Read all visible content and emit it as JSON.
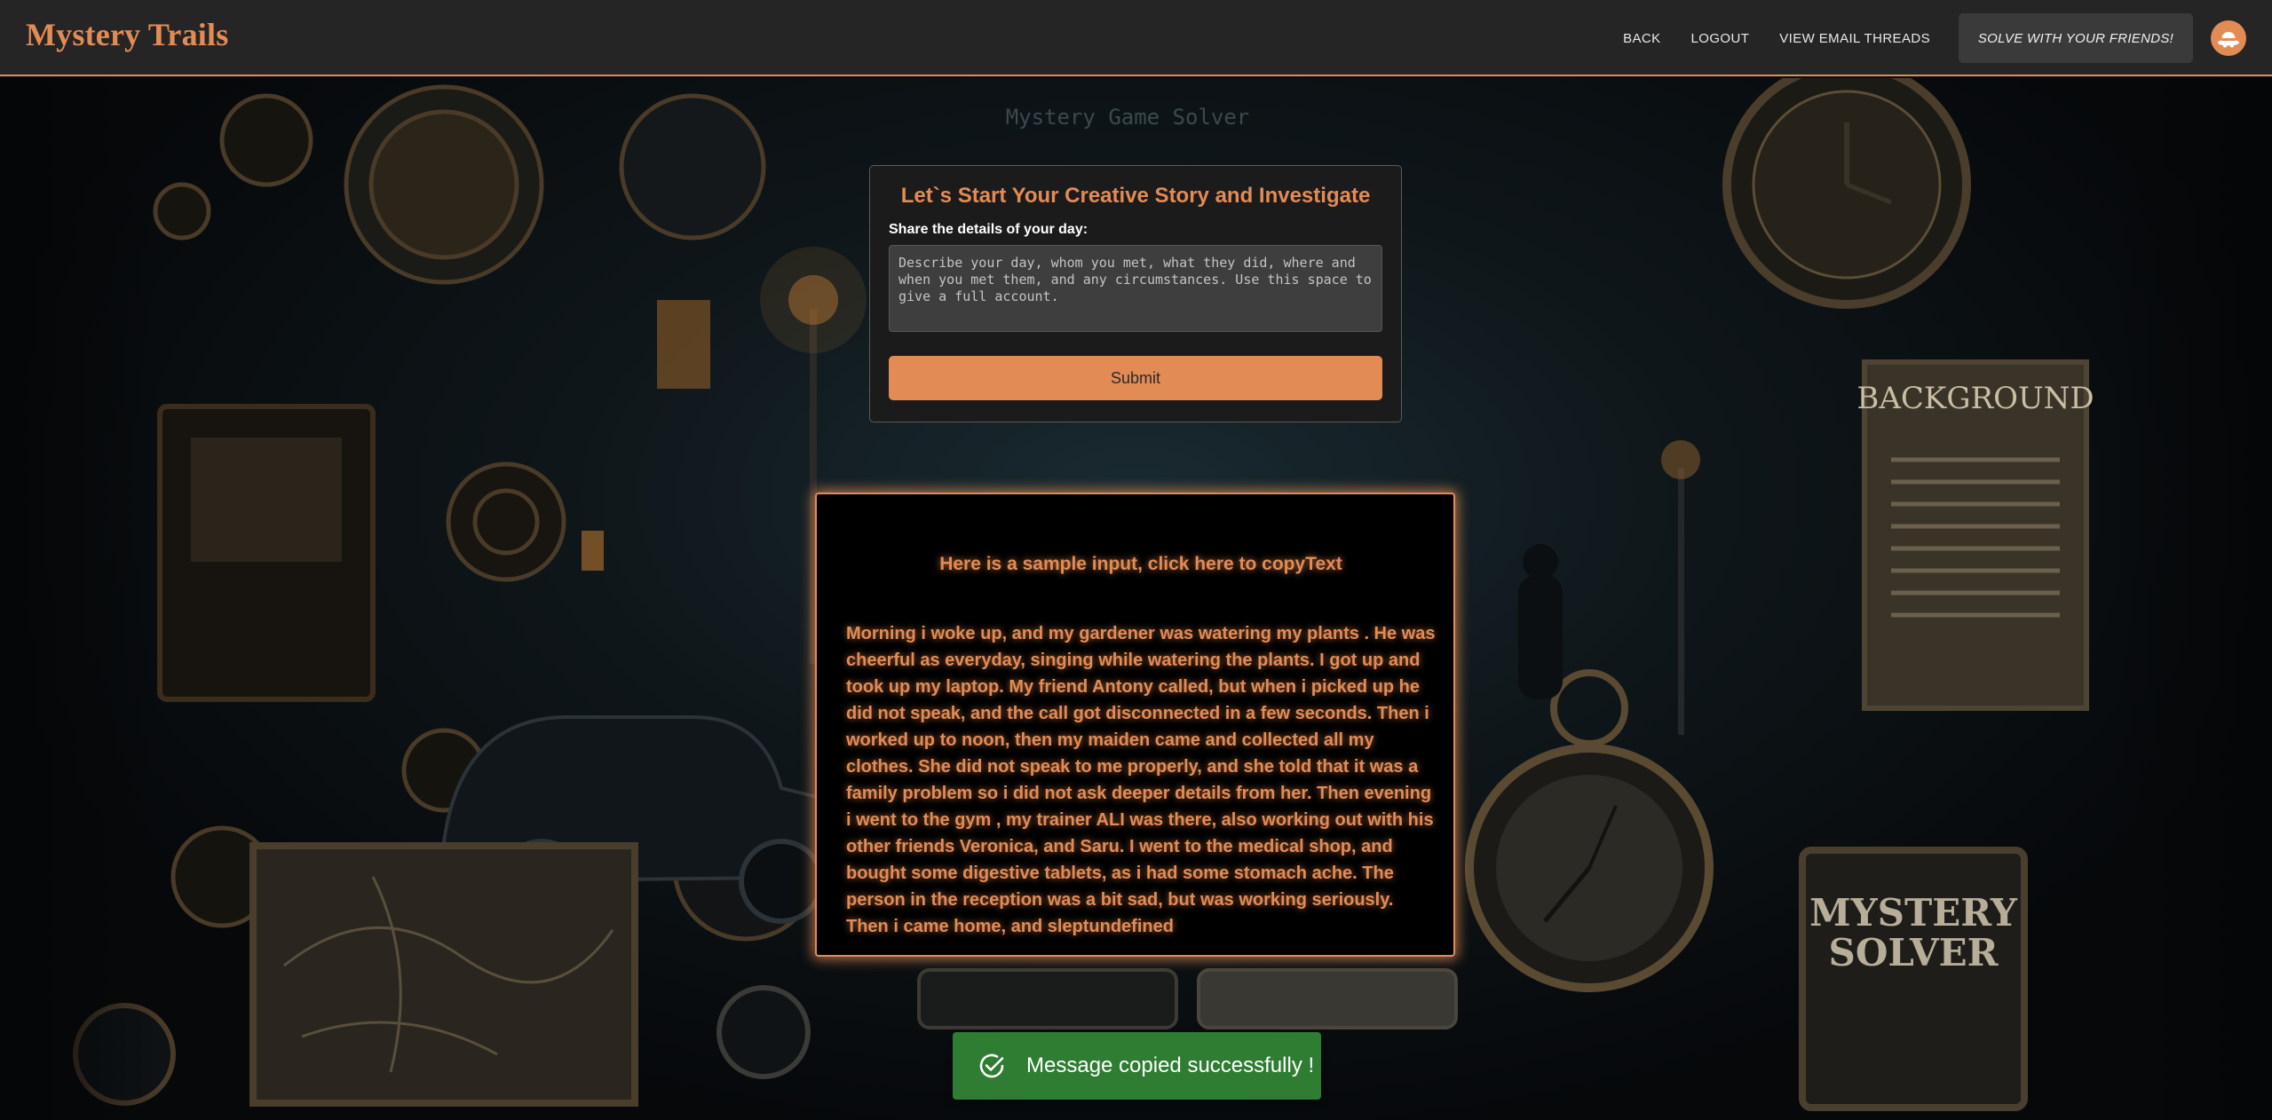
{
  "header": {
    "brand": "Mystery Trails",
    "nav": {
      "back": "BACK",
      "logout": "LOGOUT",
      "email_threads": "VIEW EMAIL THREADS",
      "cta": "SOLVE WITH YOUR FRIENDS!"
    },
    "avatar_icon": "detective-hat-icon"
  },
  "background": {
    "faint_title": "Mystery Game Solver",
    "poster_title": "BACKGROUND",
    "box_title_line1": "MYSTERY",
    "box_title_line2": "SOLVER"
  },
  "form": {
    "title": "Let`s Start Your Creative Story and Investigate",
    "label": "Share the details of your day:",
    "placeholder": "Describe your day, whom you met, what they did, where and when you met them, and any circumstances. Use this space to give a full account.",
    "value": "",
    "submit_label": "Submit"
  },
  "sample": {
    "title": "Here is a sample input, click here to copyText",
    "body": "Morning i woke up, and my gardener was watering my plants . He was cheerful as everyday, singing while watering the plants. I got up and took up my laptop. My friend Antony called, but when i picked up he did not speak, and the call got disconnected in a few seconds. Then i worked up to noon, then my maiden came and collected all my clothes. She did not speak to me properly, and she told that it was a family problem so i did not ask deeper details from her. Then evening i went to the gym , my trainer ALI was there, also working out with his other friends Veronica, and Saru. I went to the medical shop, and bought some digestive tablets, as i had some stomach ache. The person in the reception was a bit sad, but was working seriously. Then i came home, and sleptundefined"
  },
  "toast": {
    "message": "Message copied successfully !",
    "icon": "check-circle-icon",
    "color": "#2e7d32"
  },
  "colors": {
    "accent": "#e38b55",
    "header_bg": "#252526"
  }
}
